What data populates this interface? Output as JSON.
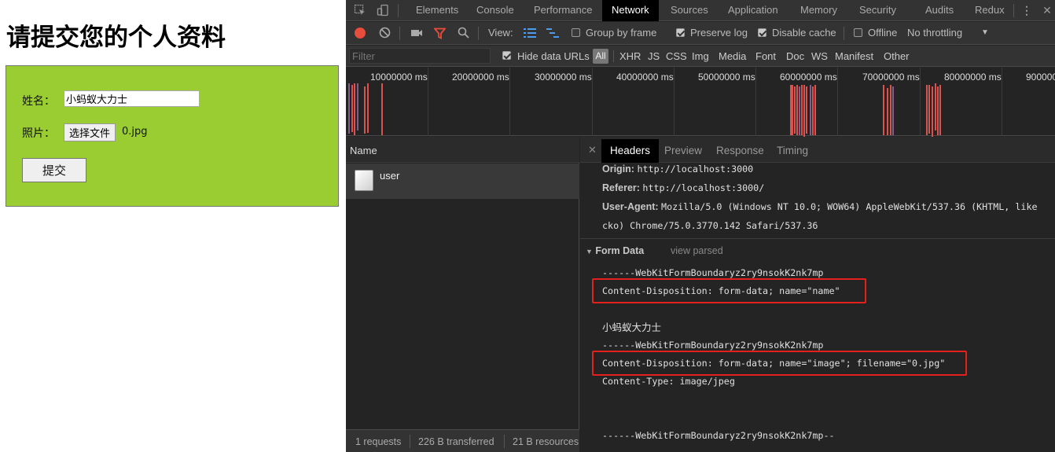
{
  "page": {
    "heading": "请提交您的个人资料",
    "name_label": "姓名：",
    "name_value": "小蚂蚁大力士",
    "photo_label": "照片：",
    "file_button": "选择文件",
    "file_name": "0.jpg",
    "submit_label": "提交",
    "form_bg": "#9acd32"
  },
  "devtools": {
    "panel_tabs": [
      "Elements",
      "Console",
      "Performance",
      "Network",
      "Sources",
      "Application",
      "Memory",
      "Security",
      "Audits",
      "Redux"
    ],
    "active_tab": "Network",
    "toolbar": {
      "view_label": "View:",
      "group_by_frame": "Group by frame",
      "group_by_frame_checked": false,
      "preserve_log": "Preserve log",
      "preserve_log_checked": true,
      "disable_cache": "Disable cache",
      "disable_cache_checked": true,
      "offline": "Offline",
      "offline_checked": false,
      "throttling": "No throttling"
    },
    "filterbar": {
      "filter_placeholder": "Filter",
      "hide_data_urls": "Hide data URLs",
      "hide_data_urls_checked": true,
      "all": "All",
      "types": [
        "XHR",
        "JS",
        "CSS",
        "Img",
        "Media",
        "Font",
        "Doc",
        "WS",
        "Manifest",
        "Other"
      ]
    },
    "timeline_ticks": [
      "10000000 ms",
      "20000000 ms",
      "30000000 ms",
      "40000000 ms",
      "50000000 ms",
      "60000000 ms",
      "70000000 ms",
      "80000000 ms",
      "900000"
    ],
    "requests": {
      "column_header": "Name",
      "rows": [
        {
          "name": "user"
        }
      ],
      "status": [
        "1 requests",
        "226 B transferred",
        "21 B resources"
      ]
    },
    "detail": {
      "tabs": [
        "Headers",
        "Preview",
        "Response",
        "Timing"
      ],
      "active_tab": "Headers",
      "headers": [
        {
          "key": "Origin:",
          "value": "http://localhost:3000"
        },
        {
          "key": "Referer:",
          "value": "http://localhost:3000/"
        },
        {
          "key": "User-Agent:",
          "value": "Mozilla/5.0 (Windows NT 10.0; WOW64) AppleWebKit/537.36 (KHTML, like"
        }
      ],
      "user_agent_cont": "cko) Chrome/75.0.3770.142 Safari/537.36",
      "form_data_title": "Form Data",
      "view_parsed": "view parsed",
      "form_data_lines": [
        "------WebKitFormBoundaryz2ry9nsokK2nk7mp",
        "Content-Disposition: form-data; name=\"name\"",
        "小蚂蚁大力士",
        "------WebKitFormBoundaryz2ry9nsokK2nk7mp",
        "Content-Disposition: form-data; name=\"image\"; filename=\"0.jpg\"",
        "Content-Type: image/jpeg",
        "------WebKitFormBoundaryz2ry9nsokK2nk7mp--"
      ],
      "highlight_color": "#e3201b"
    }
  }
}
